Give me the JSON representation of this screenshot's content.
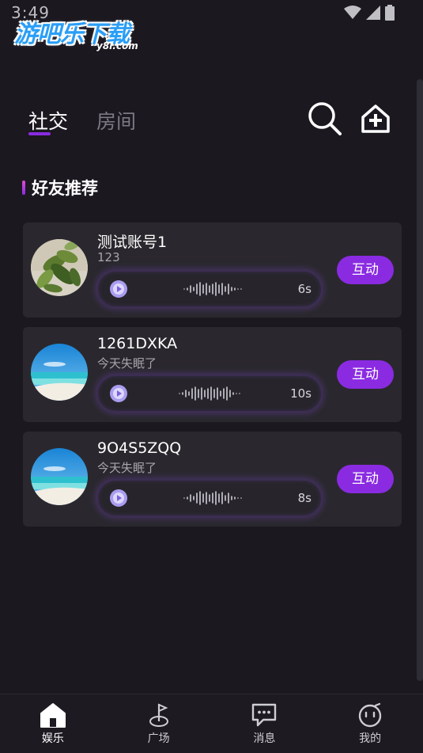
{
  "status_bar": {
    "time": "3:49"
  },
  "watermark": {
    "title": "游吧乐下载",
    "subtitle": "y8l.com"
  },
  "tabs": [
    {
      "label": "社交",
      "active": true
    },
    {
      "label": "房间",
      "active": false
    }
  ],
  "top_actions": {
    "search_icon": "search-icon",
    "home_add_icon": "home-plus-icon"
  },
  "section": {
    "title": "好友推荐"
  },
  "friends": [
    {
      "name": "测试账号1",
      "subtitle": "123",
      "voice_duration": "6s",
      "action_label": "互动",
      "avatar": "plant-photo"
    },
    {
      "name": "1261DXKA",
      "subtitle": "今天失眠了",
      "voice_duration": "10s",
      "action_label": "互动",
      "avatar": "beach-photo"
    },
    {
      "name": "9O4S5ZQQ",
      "subtitle": "今天失眠了",
      "voice_duration": "8s",
      "action_label": "互动",
      "avatar": "beach-photo"
    }
  ],
  "bottom_nav": [
    {
      "label": "娱乐",
      "icon": "home-icon",
      "active": true
    },
    {
      "label": "广场",
      "icon": "golf-flag-icon",
      "active": false
    },
    {
      "label": "消息",
      "icon": "chat-bubble-icon",
      "active": false
    },
    {
      "label": "我的",
      "icon": "face-icon",
      "active": false
    }
  ],
  "colors": {
    "background": "#1b1820",
    "card": "#2a282e",
    "accent": "#8a2be2",
    "inactive_tab": "#7c7982"
  }
}
